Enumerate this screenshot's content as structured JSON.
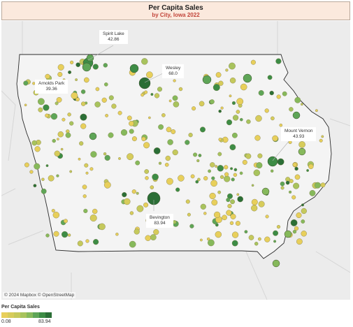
{
  "header": {
    "title": "Per Capita Sales",
    "subtitle": "by City, Iowa 2022"
  },
  "map": {
    "attribution": "© 2024 Mapbox © OpenStreetMap",
    "callouts": [
      {
        "city": "Spirit Lake",
        "value": "42.86"
      },
      {
        "city": "Wesley",
        "value": "68.0"
      },
      {
        "city": "Arnolds Park",
        "value": "39.36"
      },
      {
        "city": "Mount Vernon",
        "value": "43.93"
      },
      {
        "city": "Bevington",
        "value": "83.94"
      }
    ],
    "colors": {
      "land": "#ececec",
      "iowa": "#f4f4f4",
      "border": "#2b2b2b",
      "low": "#e3cd5c",
      "mid": "#a8c660",
      "high": "#2d7a3a"
    }
  },
  "legend": {
    "title": "Per Capita Sales",
    "min": "0.08",
    "max": "83.94",
    "swatches": [
      "#e8cf5b",
      "#d7cc5b",
      "#c5c95c",
      "#a8c35d",
      "#86b95b",
      "#5ea557",
      "#3d8c45",
      "#2b6e36"
    ]
  }
}
